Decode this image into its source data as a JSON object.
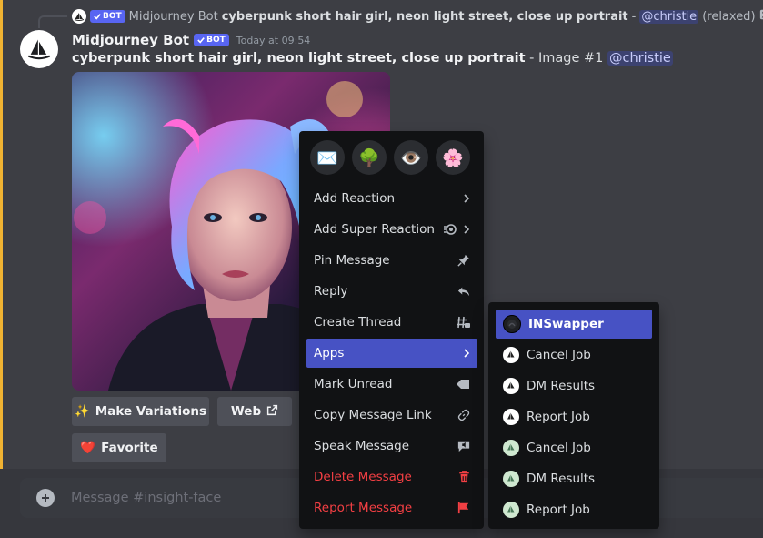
{
  "reply": {
    "bot_name": "Midjourney Bot",
    "bot_tag": "BOT",
    "prompt": "cyberpunk short hair girl, neon light street, close up portrait",
    "separator": "-",
    "mention": "@christie",
    "mode": "(relaxed)"
  },
  "message": {
    "username": "Midjourney Bot",
    "bot_tag": "BOT",
    "timestamp": "Today at 09:54",
    "prompt": "cyberpunk short hair girl, neon light street, close up portrait",
    "suffix": " - Image #1 ",
    "mention": "@christie"
  },
  "buttons": {
    "variations_icon": "✨",
    "variations": "Make Variations",
    "web": "Web",
    "favorite_icon": "❤️",
    "favorite": "Favorite"
  },
  "input": {
    "placeholder": "Message #insight-face"
  },
  "context_menu": {
    "emojis": [
      "✉️",
      "🌳",
      "👁️",
      "🌸"
    ],
    "items": [
      {
        "label": "Add Reaction"
      },
      {
        "label": "Add Super Reaction"
      },
      {
        "label": "Pin Message"
      },
      {
        "label": "Reply"
      },
      {
        "label": "Create Thread"
      },
      {
        "label": "Apps"
      },
      {
        "label": "Mark Unread"
      },
      {
        "label": "Copy Message Link"
      },
      {
        "label": "Speak Message"
      },
      {
        "label": "Delete Message"
      },
      {
        "label": "Report Message"
      }
    ]
  },
  "apps_submenu": {
    "items": [
      {
        "label": "INSwapper"
      },
      {
        "label": "Cancel Job"
      },
      {
        "label": "DM Results"
      },
      {
        "label": "Report Job"
      },
      {
        "label": "Cancel Job"
      },
      {
        "label": "DM Results"
      },
      {
        "label": "Report Job"
      }
    ]
  },
  "colors": {
    "accent": "#5865f2",
    "active_item": "#4752c4",
    "danger": "#f23f43",
    "highlight": "#f0b232"
  }
}
